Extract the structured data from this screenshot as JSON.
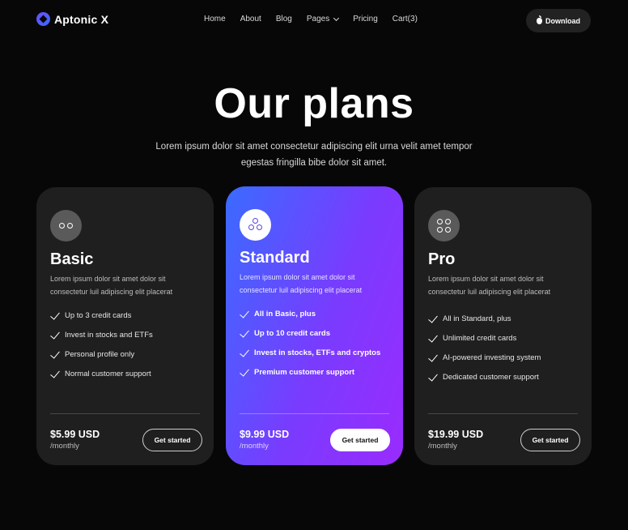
{
  "header": {
    "brand": "Aptonic X",
    "nav": [
      {
        "label": "Home"
      },
      {
        "label": "About"
      },
      {
        "label": "Blog"
      },
      {
        "label": "Pages",
        "has_dropdown": true
      },
      {
        "label": "Pricing"
      },
      {
        "label": "Cart(3)"
      }
    ],
    "download_label": "Download",
    "download_icon": "apple-icon"
  },
  "hero": {
    "title": "Our plans",
    "subtitle": "Lorem ipsum dolor sit amet consectetur adipiscing elit urna velit amet tempor egestas fringilla bibe dolor sit amet."
  },
  "plans": [
    {
      "name": "Basic",
      "icon": "two-circles-icon",
      "description": "Lorem ipsum dolor sit amet dolor sit consectetur luil adipiscing elit placerat",
      "features": [
        "Up to 3 credit cards",
        "Invest in stocks and ETFs",
        "Personal profile only",
        "Normal customer support"
      ],
      "price": "$5.99 USD",
      "period": "/monthly",
      "cta": "Get started"
    },
    {
      "name": "Standard",
      "icon": "three-circles-icon",
      "highlighted": true,
      "description": "Lorem ipsum dolor sit amet dolor sit consectetur luil adipiscing elit placerat",
      "features": [
        "All in Basic, plus",
        "Up to 10 credit cards",
        "Invest in stocks, ETFs and cryptos",
        "Premium customer support"
      ],
      "price": "$9.99 USD",
      "period": "/monthly",
      "cta": "Get started"
    },
    {
      "name": "Pro",
      "icon": "four-circles-icon",
      "description": "Lorem ipsum dolor sit amet dolor sit consectetur luil adipiscing elit placerat",
      "features": [
        "All in Standard, plus",
        "Unlimited credit cards",
        "AI-powered investing system",
        "Dedicated customer support"
      ],
      "price": "$19.99 USD",
      "period": "/monthly",
      "cta": "Get started"
    }
  ],
  "colors": {
    "background": "#070707",
    "card": "#1f1f1f",
    "accent_gradient_start": "#3a6bff",
    "accent_gradient_end": "#9a2bff"
  }
}
